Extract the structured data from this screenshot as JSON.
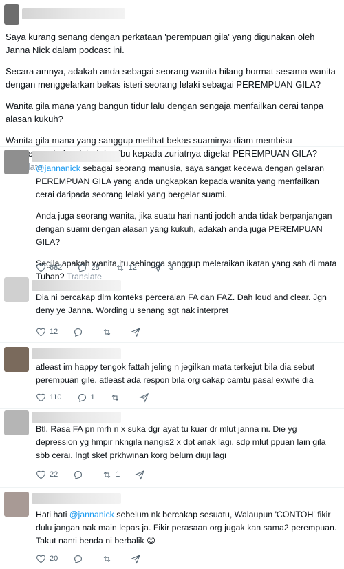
{
  "main_post": {
    "paragraphs": [
      "Saya kurang senang dengan perkataan 'perempuan gila' yang digunakan oleh Janna Nick dalam podcast ini.",
      "Secara amnya, adakah anda sebagai seorang wanita hilang hormat sesama wanita dengan menggelarkan bekas isteri seorang lelaki sebagai PEREMPUAN GILA?",
      "Wanita gila mana yang bangun tidur lalu dengan sengaja menfailkan cerai tanpa alasan kukuh?",
      "Wanita gila mana yang sanggup melihat bekas suaminya diam membisu mendengar bekas isteri dan ibu kepada zuriatnya digelar PEREMPUAN GILA?"
    ],
    "translate_label": "Translate"
  },
  "replies": [
    {
      "mention": "@jannanick",
      "paragraphs": [
        " sebagai seorang manusia, saya sangat kecewa dengan gelaran PEREMPUAN GILA yang anda ungkapkan kepada wanita yang menfailkan cerai daripada seorang lelaki yang bergelar suami.",
        "Anda juga seorang wanita, jika suatu hari nanti jodoh anda tidak berpanjangan dengan suami dengan alasan yang kukuh, adakah anda juga PEREMPUAN GILA?",
        "Segila apakah wanita itu sehingga sanggup meleraikan ikatan yang sah di mata Tuhan?"
      ],
      "translate_label": "Translate",
      "likes": "682",
      "replies": "28",
      "reposts": "12",
      "shares": "3"
    },
    {
      "paragraphs": [
        "Dia ni bercakap dlm konteks perceraian FA dan FAZ. Dah loud and clear. Jgn deny ye Janna. Wording u senang sgt nak interpret"
      ],
      "likes": "12"
    },
    {
      "paragraphs": [
        "atleast im happy tengok fattah jeling n jegilkan mata terkejut bila dia sebut perempuan gile. atleast ada respon bila org cakap camtu pasal exwife dia"
      ],
      "likes": "110",
      "replies": "1"
    },
    {
      "paragraphs": [
        "Btl. Rasa FA pn mrh n x suka dgr ayat tu kuar dr mlut janna ni. Die yg depression yg hmpir nkngila nangis2 x dpt anak lagi, sdp mlut ppuan lain gila sbb cerai. Ingt sket prkhwinan korg belum diuji lagi"
      ],
      "likes": "22",
      "reposts": "1"
    },
    {
      "text_before": "Hati hati ",
      "mention": "@jannanick",
      "text_after": " sebelum nk bercakap sesuatu, Walaupun 'CONTOH' fikir dulu jangan nak main lepas ja. Fikir perasaan org jugak kan sama2 perempuan. Takut nanti benda ni berbalik 😊",
      "likes": "20"
    }
  ],
  "icons": {
    "like": "heart-icon",
    "reply": "comment-icon",
    "repost": "repost-icon",
    "share": "share-icon"
  },
  "colors": {
    "link": "#1d9bf0",
    "muted": "#536471",
    "translate": "#8b98a5"
  }
}
